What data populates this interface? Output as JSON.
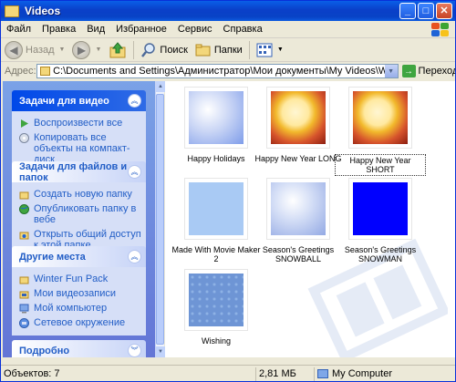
{
  "window": {
    "title": "Videos"
  },
  "menu": [
    "Файл",
    "Правка",
    "Вид",
    "Избранное",
    "Сервис",
    "Справка"
  ],
  "toolbar": {
    "back": "Назад",
    "search": "Поиск",
    "folders": "Папки"
  },
  "address": {
    "label": "Адрес:",
    "path": "C:\\Documents and Settings\\Администратор\\Мои документы\\My Videos\\Winter Fun Pack\\Videos",
    "go": "Переход"
  },
  "panels": {
    "video_tasks": {
      "title": "Задачи для видео",
      "items": [
        "Воспроизвести все",
        "Копировать все объекты на компакт-диск"
      ]
    },
    "file_tasks": {
      "title": "Задачи для файлов и папок",
      "items": [
        "Создать новую папку",
        "Опубликовать папку в вебе",
        "Открыть общий доступ к этой папке"
      ]
    },
    "other_places": {
      "title": "Другие места",
      "items": [
        "Winter Fun Pack",
        "Мои видеозаписи",
        "Мой компьютер",
        "Сетевое окружение"
      ]
    },
    "details": {
      "title": "Подробно"
    }
  },
  "files": [
    {
      "name": "Happy Holidays",
      "thumb": "blue-radial"
    },
    {
      "name": "Happy New Year LONG",
      "thumb": "golden-flowers"
    },
    {
      "name": "Happy New Year SHORT",
      "thumb": "golden-flowers",
      "selected": true
    },
    {
      "name": "Made With Movie Maker 2",
      "thumb": "light-blue"
    },
    {
      "name": "Season's Greetings SNOWBALL",
      "thumb": "blue-radial"
    },
    {
      "name": "Season's Greetings SNOWMAN",
      "thumb": "solid-blue"
    },
    {
      "name": "Wishing",
      "thumb": "snowflake-pattern"
    }
  ],
  "status": {
    "objects": "Объектов: 7",
    "size": "2,81 МБ",
    "location": "My Computer"
  },
  "colors": {
    "titlebar": "#0A3FC8",
    "panel_bg": "#6375D6",
    "panel_link": "#215DC6",
    "snowman_thumb": "#0000FF"
  }
}
